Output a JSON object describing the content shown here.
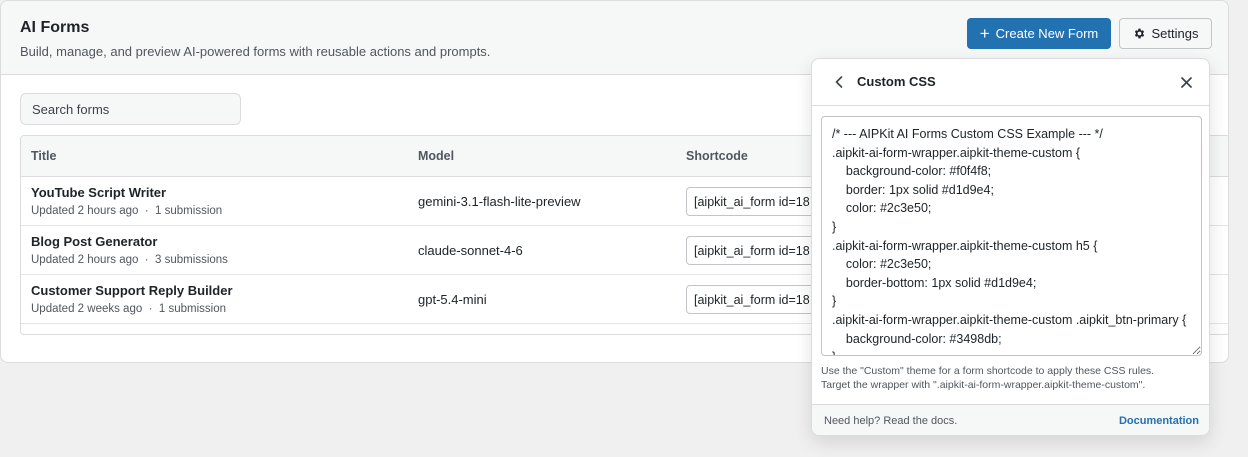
{
  "header": {
    "title": "AI Forms",
    "subtitle": "Build, manage, and preview AI-powered forms with reusable actions and prompts.",
    "create_label": "Create New Form",
    "settings_label": "Settings"
  },
  "search": {
    "placeholder": "Search forms"
  },
  "table": {
    "columns": {
      "title": "Title",
      "model": "Model",
      "shortcode": "Shortcode"
    },
    "rows": [
      {
        "title": "YouTube Script Writer",
        "updated": "Updated 2 hours ago",
        "submissions": "1 submission",
        "model": "gemini-3.1-flash-lite-preview",
        "shortcode": "[aipkit_ai_form id=18"
      },
      {
        "title": "Blog Post Generator",
        "updated": "Updated 2 hours ago",
        "submissions": "3 submissions",
        "model": "claude-sonnet-4-6",
        "shortcode": "[aipkit_ai_form id=18"
      },
      {
        "title": "Customer Support Reply Builder",
        "updated": "Updated 2 weeks ago",
        "submissions": "1 submission",
        "model": "gpt-5.4-mini",
        "shortcode": "[aipkit_ai_form id=18"
      }
    ]
  },
  "panel": {
    "title": "Custom CSS",
    "css": "/* --- AIPKit AI Forms Custom CSS Example --- */\n.aipkit-ai-form-wrapper.aipkit-theme-custom {\n    background-color: #f0f4f8;\n    border: 1px solid #d1d9e4;\n    color: #2c3e50;\n}\n.aipkit-ai-form-wrapper.aipkit-theme-custom h5 {\n    color: #2c3e50;\n    border-bottom: 1px solid #d1d9e4;\n}\n.aipkit-ai-form-wrapper.aipkit-theme-custom .aipkit_btn-primary {\n    background-color: #3498db;\n}",
    "help_line1": "Use the \"Custom\" theme for a form shortcode to apply these CSS rules.",
    "help_line2": "Target the wrapper with \".aipkit-ai-form-wrapper.aipkit-theme-custom\".",
    "footer_text": "Need help? Read the docs.",
    "footer_link": "Documentation"
  },
  "icons": {
    "create": "plus-icon",
    "settings": "gear-icon",
    "back": "chevron-left-icon",
    "close": "close-icon"
  },
  "colors": {
    "primary": "#2271b1",
    "text": "#1d2327",
    "muted": "#50575e",
    "border": "#dcdcde"
  }
}
